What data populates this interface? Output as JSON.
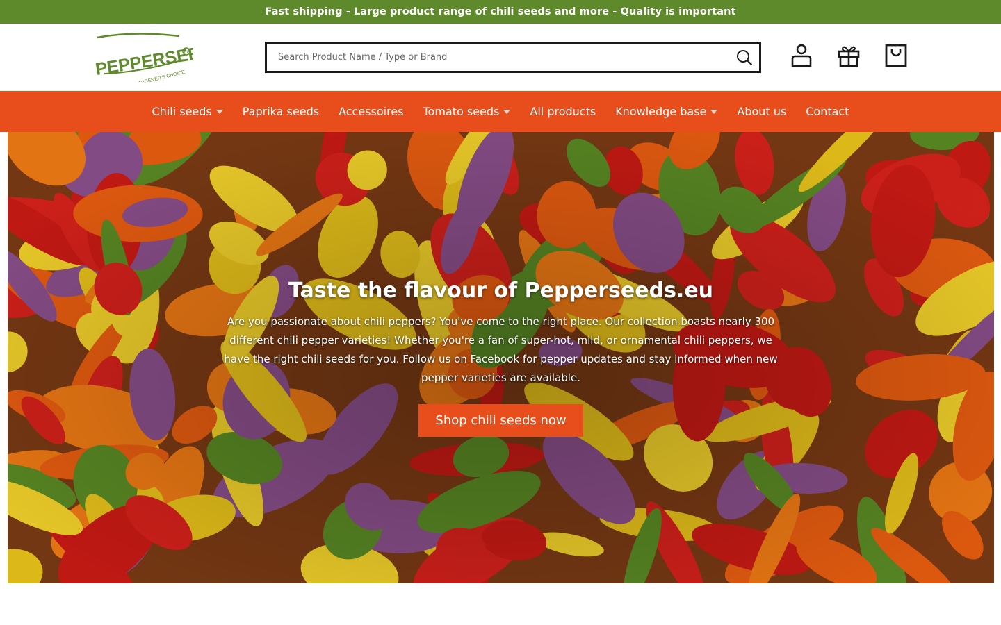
{
  "topbar": {
    "text": "Fast shipping - Large product range of chili seeds and more - Quality is important",
    "color": "#5f8a2c"
  },
  "header": {
    "logo": {
      "brand": "PEPPERSEEDS",
      "tagline": "THE CHILI GARDENER'S CHOICE",
      "badge": "EU",
      "color": "#5f8a2c"
    },
    "search": {
      "placeholder": "Search Product Name / Type or Brand",
      "value": "",
      "icon": "search-icon"
    },
    "icons": [
      "user-icon",
      "gift-icon",
      "shopping-bag-icon"
    ]
  },
  "nav": {
    "color": "#e84e1b",
    "items": [
      {
        "label": "Chili seeds",
        "has_dropdown": true
      },
      {
        "label": "Paprika seeds",
        "has_dropdown": false
      },
      {
        "label": "Accessoires",
        "has_dropdown": false
      },
      {
        "label": "Tomato seeds",
        "has_dropdown": true
      },
      {
        "label": "All products",
        "has_dropdown": false
      },
      {
        "label": "Knowledge base",
        "has_dropdown": true
      },
      {
        "label": "About us",
        "has_dropdown": false
      },
      {
        "label": "Contact",
        "has_dropdown": false
      }
    ]
  },
  "hero": {
    "title": "Taste the flavour of Pepperseeds.eu",
    "text": "Are you passionate about chili peppers? You've come to the right place. Our collection boasts nearly 300 different chili pepper varieties! Whether you're a fan of super-hot, mild, or ornamental chili peppers, we have the right chili seeds for you. Follow us on Facebook for pepper updates and stay informed when new pepper varieties are available.",
    "button_label": "Shop chili seeds now",
    "button_color": "#e84e1b"
  }
}
